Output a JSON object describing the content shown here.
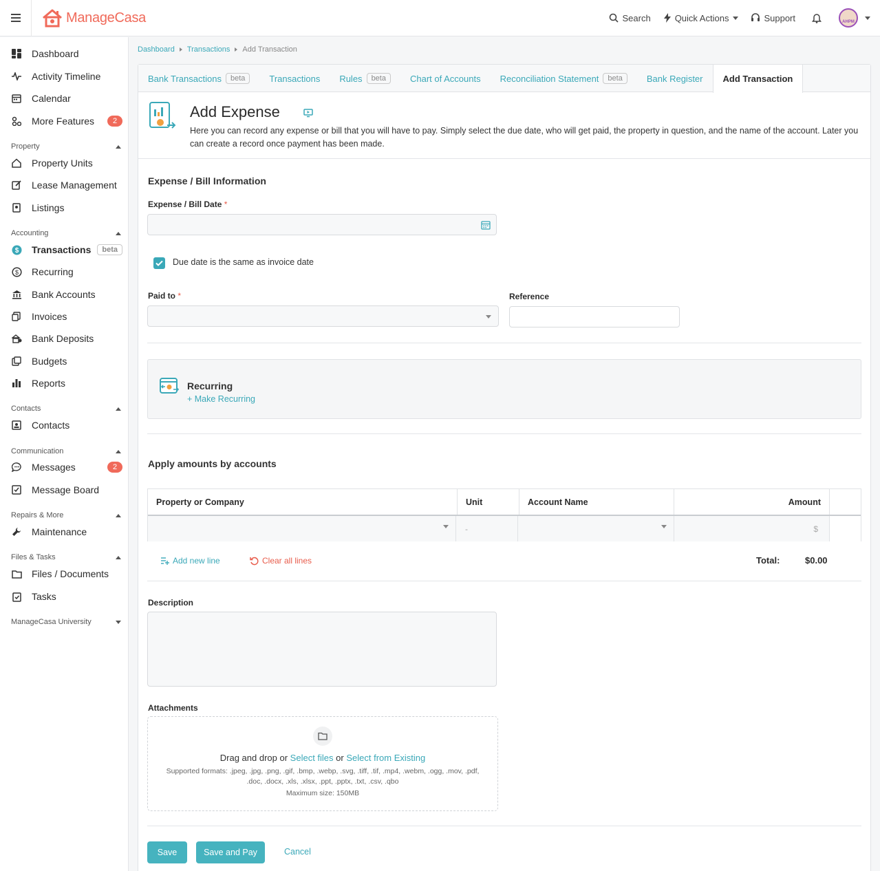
{
  "app": {
    "logo_text_a": "Manage",
    "logo_text_b": "Casa",
    "brand_color": "#f06a5a",
    "accent_color": "#3aa8b8"
  },
  "topbar": {
    "search": "Search",
    "quick_actions": "Quick Actions",
    "support": "Support",
    "avatar_initials": "AHPM"
  },
  "sidebar": {
    "dashboard": "Dashboard",
    "activity": "Activity Timeline",
    "calendar": "Calendar",
    "more_features": "More Features",
    "more_features_badge": "2",
    "sec_property": "Property",
    "property_units": "Property Units",
    "lease_management": "Lease Management",
    "listings": "Listings",
    "sec_accounting": "Accounting",
    "transactions": "Transactions",
    "transactions_beta": "beta",
    "recurring": "Recurring",
    "bank_accounts": "Bank Accounts",
    "invoices": "Invoices",
    "bank_deposits": "Bank Deposits",
    "budgets": "Budgets",
    "reports": "Reports",
    "sec_contacts": "Contacts",
    "contacts": "Contacts",
    "sec_communication": "Communication",
    "messages": "Messages",
    "messages_badge": "2",
    "message_board": "Message Board",
    "sec_repairs": "Repairs & More",
    "maintenance": "Maintenance",
    "sec_files": "Files & Tasks",
    "files_documents": "Files / Documents",
    "tasks": "Tasks",
    "sec_university": "ManageCasa University"
  },
  "breadcrumb": {
    "dashboard": "Dashboard",
    "transactions": "Transactions",
    "current": "Add Transaction"
  },
  "tabs": {
    "bank_transactions": "Bank Transactions",
    "beta": "beta",
    "transactions": "Transactions",
    "rules": "Rules",
    "chart_of_accounts": "Chart of Accounts",
    "reconciliation": "Reconciliation Statement",
    "bank_register": "Bank Register",
    "add_transaction": "Add Transaction"
  },
  "header": {
    "title": "Add Expense",
    "description": "Here you can record any expense or bill that you will have to pay. Simply select the due date, who will get paid, the property in question, and the name of the account. Later you can create a record once payment has been made."
  },
  "form": {
    "section_info": "Expense / Bill Information",
    "date_label": "Expense / Bill Date",
    "required_mark": "*",
    "due_same_label": "Due date is the same as invoice date",
    "paid_to_label": "Paid to",
    "reference_label": "Reference",
    "recurring_title": "Recurring",
    "make_recurring": "+ Make Recurring",
    "apply_title": "Apply amounts by accounts",
    "col_property": "Property or Company",
    "col_unit": "Unit",
    "col_account": "Account Name",
    "col_amount": "Amount",
    "unit_placeholder": "-",
    "amount_placeholder": "$",
    "add_new_line": "Add new line",
    "clear_all_lines": "Clear all lines",
    "total_label": "Total:",
    "total_value": "$0.00",
    "description_label": "Description",
    "attachments_label": "Attachments",
    "drag_drop": "Drag and drop or",
    "select_files": "Select files",
    "or": "or",
    "select_existing": "Select from Existing",
    "formats": "Supported formats: .jpeg, .jpg, .png, .gif, .bmp, .webp, .svg, .tiff, .tif, .mp4, .webm, .ogg, .mov, .pdf, .doc, .docx, .xls, .xlsx, .ppt, .pptx, .txt, .csv, .qbo",
    "max_size": "Maximum size: 150MB"
  },
  "actions": {
    "save": "Save",
    "save_and_pay": "Save and Pay",
    "cancel": "Cancel"
  }
}
